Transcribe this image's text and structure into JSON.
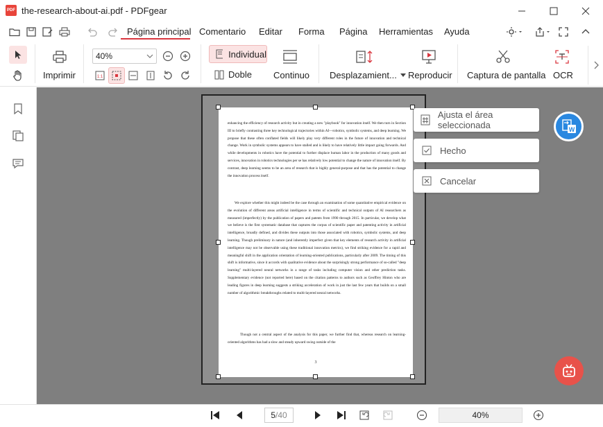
{
  "window": {
    "title": "the-research-about-ai.pdf - PDFgear",
    "logo_text": "PDF"
  },
  "menu": {
    "items": [
      "Página principal",
      "Comentario",
      "Editar",
      "Forma",
      "Página",
      "Herramientas",
      "Ayuda"
    ],
    "active_index": 0
  },
  "toolbar": {
    "print_label": "Imprimir",
    "zoom_value": "40%",
    "single_label": "Individual",
    "double_label": "Doble",
    "continuous_label": "Continuo",
    "scroll_label": "Desplazamient...",
    "play_label": "Reproducir",
    "screenshot_label": "Captura de pantalla",
    "ocr_label": "OCR"
  },
  "selection_panel": {
    "fit_label": "Ajusta el área seleccionada",
    "done_label": "Hecho",
    "cancel_label": "Cancelar"
  },
  "document": {
    "paragraph1": "enhancing the efficiency of research activity but in creating a new \"playbook\" for innovation itself. We then turn in Section III to briefly contrasting three key technological trajectories within AI—robotics, symbolic systems, and deep learning. We propose that these often conflated fields will likely play very different roles in the future of innovation and technical change. Work in symbolic systems appears to have stalled and is likely to have relatively little impact going forwards. And while developments in robotics have the potential to further displace human labor in the production of many goods and services, innovation in robotics technologies per se has relatively low potential to change the nature of innovation itself. By contrast, deep learning seems to be an area of research that is highly general-purpose and that has the potential to change the innovation process itself.",
    "paragraph2": "We explore whether this might indeed be the case through an examination of some quantitative empirical evidence on the evolution of different areas artificial intelligence in terms of scientific and technical outputs of AI researchers as measured (imperfectly) by the publication of papers and patents from 1990 through 2015. In particular, we develop what we believe is the first systematic database that captures the corpus of scientific paper and patenting activity in artificial intelligence, broadly defined, and divides these outputs into those associated with robotics, symbolic systems, and deep learning. Though preliminary in nature (and inherently imperfect given that key elements of research activity in artificial intelligence may not be observable using these traditional innovation metrics), we find striking evidence for a rapid and meaningful shift in the application orientation of learning-oriented publications, particularly after 2009. The timing of this shift is informative, since it accords with qualitative evidence about the surprisingly strong performance of so-called \"deep learning\" multi-layered neural networks in a range of tasks including computer vision and other prediction tasks. Supplementary evidence (not reported here) based on the citation patterns to authors such as Geoffrey Hinton who are leading figures in deep learning suggests a striking acceleration of work in just the last few years that builds on a small number of algorithmic breakthroughs related to multi-layered neural networks.",
    "paragraph3": "Though not a central aspect of the analysis for this paper, we further find that, whereas research on learning-oriented algorithms has had a slow and steady upward swing outside of the",
    "page_footer": "3"
  },
  "navigation": {
    "current_page": "5",
    "total_pages": "/40",
    "zoom": "40%"
  },
  "colors": {
    "accent_red": "#d9363e",
    "convert_blue": "#2a88e0",
    "viewer_gray": "#7f7f7f"
  }
}
